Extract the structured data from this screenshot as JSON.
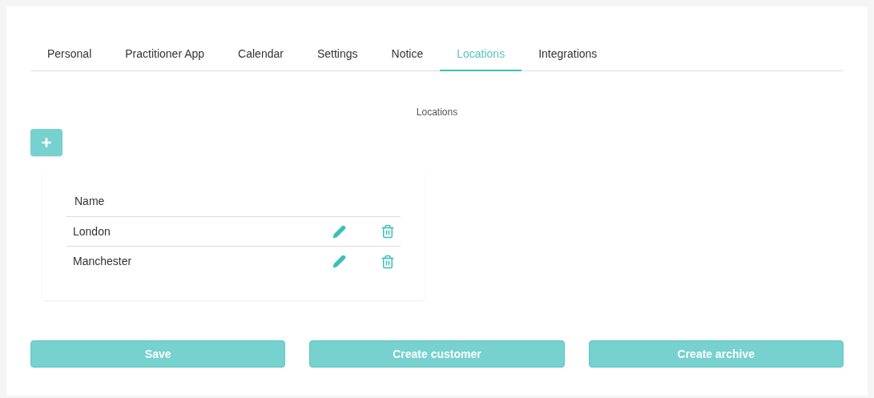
{
  "tabs": [
    {
      "label": "Personal",
      "selected": false
    },
    {
      "label": "Practitioner App",
      "selected": false
    },
    {
      "label": "Calendar",
      "selected": false
    },
    {
      "label": "Settings",
      "selected": false
    },
    {
      "label": "Notice",
      "selected": false
    },
    {
      "label": "Locations",
      "selected": true
    },
    {
      "label": "Integrations",
      "selected": false
    }
  ],
  "section_title": "Locations",
  "table": {
    "columns": [
      "Name"
    ],
    "rows": [
      {
        "name": "London"
      },
      {
        "name": "Manchester"
      }
    ]
  },
  "buttons": [
    "Save",
    "Create customer",
    "Create archive"
  ]
}
